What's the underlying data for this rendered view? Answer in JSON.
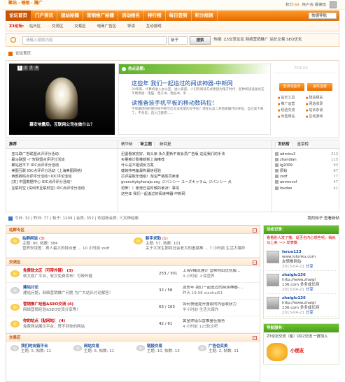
{
  "topbar": {
    "logo": "聚站 · 睡眠 · 赚广",
    "credits_label": "积分:",
    "credits_value": "55",
    "user_label": "用户名:",
    "user_name": "睿德凯"
  },
  "nav": {
    "items": [
      "论坛首页",
      "门户资讯",
      "建站秘籍",
      "营销推广秘籍",
      "活动报名",
      "排行榜",
      "每日签到",
      "积分规则"
    ],
    "quick_nav": "快捷导航"
  },
  "subnav": {
    "label": "Z3论坛:",
    "items": [
      "站长区",
      "交流区",
      "交易区",
      "电商广告区",
      "导读",
      "互动游戏"
    ]
  },
  "search": {
    "placeholder": "请输入搜索内容",
    "scope": "帖子",
    "button": "搜索",
    "hot": "热搜: Z3交流论坛 网络营销推广 站长交易 SEO优化"
  },
  "breadcrumb": "论坛首页",
  "slider": {
    "pages": [
      "1",
      "2",
      "3",
      "4"
    ],
    "caption": "慕安地震后，互联网公司在做什么？"
  },
  "hot": {
    "header": "热点话题:",
    "title1": "这些年 我们一起追过的阅读神器-中新网",
    "para": "20年来，计算机进入办公室、进入家庭，人们的阅读方式更因为电子时代，各种阅读设备也在不断改进：电脑、电子书、电纸书、手……",
    "title2": "读推备装手机平板的移动数码拉！",
    "para2": "不到最佳同的便已经不断写出文本装量的文字拉？现在从高二开始接触代码开始，自己该下来了，不多说，直入正题吧……"
  },
  "focus": {
    "label": "FOCUS",
    "buttons": [
      "登录领金币",
      "抽奖送豪"
    ],
    "links": [
      "站长工具",
      "建站相关",
      "推广运营",
      "网站收录",
      "经验交流",
      "站长杂谈",
      "出售网站",
      "互动游戏"
    ]
  },
  "recommend": {
    "title": "推荐",
    "items": [
      "亚马联广告联盟点评评分活动",
      "赢马联盟 -厂告联盟点评评分活动",
      "聚站赶不下 IDC点评评分活动",
      "美图互联 IDC点评评分活动（上海美图网络）",
      "西部数码点评评分活动~IDC评论活动",
      "[关] 中国数据中心 IDC点评评分活动！",
      "互联时空 (深圳市互联时空) IDC点评评分活动"
    ]
  },
  "posts": {
    "tabs": [
      "精华帖",
      "新主题",
      "新回复"
    ],
    "active_tab": "新主题",
    "items": [
      "迅雷看家完好，有头家 永久更新不收会员广告版 这是我们的手法",
      "买量推计账推断新上海推荐",
      "什么是不错调反方案",
      "健装持电备最构最信经验",
      "芯评提取年值组！淘宝严格惩罚卖家",
      "gvancitybyhorajo.org, ジバンシー ユーズキャラム, ジバンシー 犬",
      "恐怖！！帐死已是时候的拿对！事情",
      "这些年 我们一起追过的阅读神器-中新网"
    ]
  },
  "ranking": {
    "tabs": [
      "发帖榜",
      "富豪榜"
    ],
    "items": [
      {
        "name": "admins2",
        "count": "213"
      },
      {
        "name": "zhandian",
        "count": "115"
      },
      {
        "name": "lg2009",
        "count": "93"
      },
      {
        "name": "原始",
        "count": "87"
      },
      {
        "name": "zsdf",
        "count": "77"
      },
      {
        "name": "ammnvsf",
        "count": "47"
      },
      {
        "name": "lovdan",
        "count": "41"
      }
    ]
  },
  "stats": {
    "text": "今日: 32 | 昨日: 77 | 帖子: 1209 | 会员: 352 | 欢迎新会员: 三叉神经痛",
    "right": "我的帖子 查看新帖"
  },
  "forum": {
    "cat1": "站群专区",
    "boards_a": [
      {
        "name": "站群闲谈",
        "new": "(3)",
        "stats": "主题: 90, 帖数: 384",
        "last": "营养安误差：男人最大的特点是 … 10 小时前 zsdf"
      },
      {
        "name": "新手求助",
        "new": "(1)",
        "stats": "主题: 57, 帖数: 101",
        "last": "关于大学生刚到社会老大的困惑推 … 7 小时前 生活大爆炸"
      }
    ],
    "cat2": "交流区",
    "rows": [
      {
        "name": "免费软文区（可带外链）",
        "new": "(3)",
        "desc": "软文原广平台，软文免费发布！可带外链",
        "count": "253 / 301",
        "last1": "上海V绳流通计 营帮你出优化服…",
        "last2": "4 小时前 上海营养"
      },
      {
        "name": "建站讨论",
        "new": "",
        "desc": "建站问题，网络营销推广问题 为广大站长讨论解答！",
        "count": "32 / 58",
        "last1": "这些年 我们一起追过的阅读神器-…",
        "last2": "昨天 19:08 xiaohai51"
      },
      {
        "name": "营销推广经验&SEO交流",
        "new": "(4)",
        "desc": "网络营销经验&SEO交流分享等！",
        "count": "63 / 103",
        "last1": "如何快速提升搜索的内容收获力",
        "last2": "半小时前 生活大爆炸"
      },
      {
        "name": "你的站点（贴网站）",
        "new": "(4)",
        "desc": "免费网站展示平台，赞不到你的网站",
        "count": "42 / 61",
        "last1": "黄金你借以营推量佳服务",
        "last2": "4 小时前 123软文吧"
      }
    ],
    "cat3": "交易区",
    "boards_c": [
      {
        "name": "我们的友链平台",
        "stats": "主题: 5, 帖数: 11"
      },
      {
        "name": "网站交易",
        "stats": "主题: 5, 帖数: 11"
      },
      {
        "name": "链接交易",
        "stats": "主题: 10, 帖数: 13"
      },
      {
        "name": "广告位买卖",
        "stats": "主题: 2, 帖数: 11"
      }
    ]
  },
  "side": {
    "dynamic_title": "动态记录：",
    "note": "看看别人发了撒，是否也内心想些呢，稍就马上来 ～> 发表撒",
    "entries": [
      {
        "user": "Ieruo123",
        "text": "www.lolonku.com",
        "text2": "友情推网站",
        "date": "2013-04-21",
        "tag": "分享"
      },
      {
        "user": "zhaiglo136",
        "text": "http://www.zhaigl",
        "text2": "136.com 多多成长网",
        "date": "2013-04-21",
        "tag": "分享"
      },
      {
        "user": "zhaiglo136",
        "text": "http://www.zhaigl",
        "text2": "136.com 多多成长网",
        "date": "2013-04-21",
        "tag": "分享"
      }
    ],
    "service_title": "导航服务：",
    "service_text": "Z3论坛交流（客）QQ2交流 一群加入",
    "ad_label": "小朋友"
  }
}
